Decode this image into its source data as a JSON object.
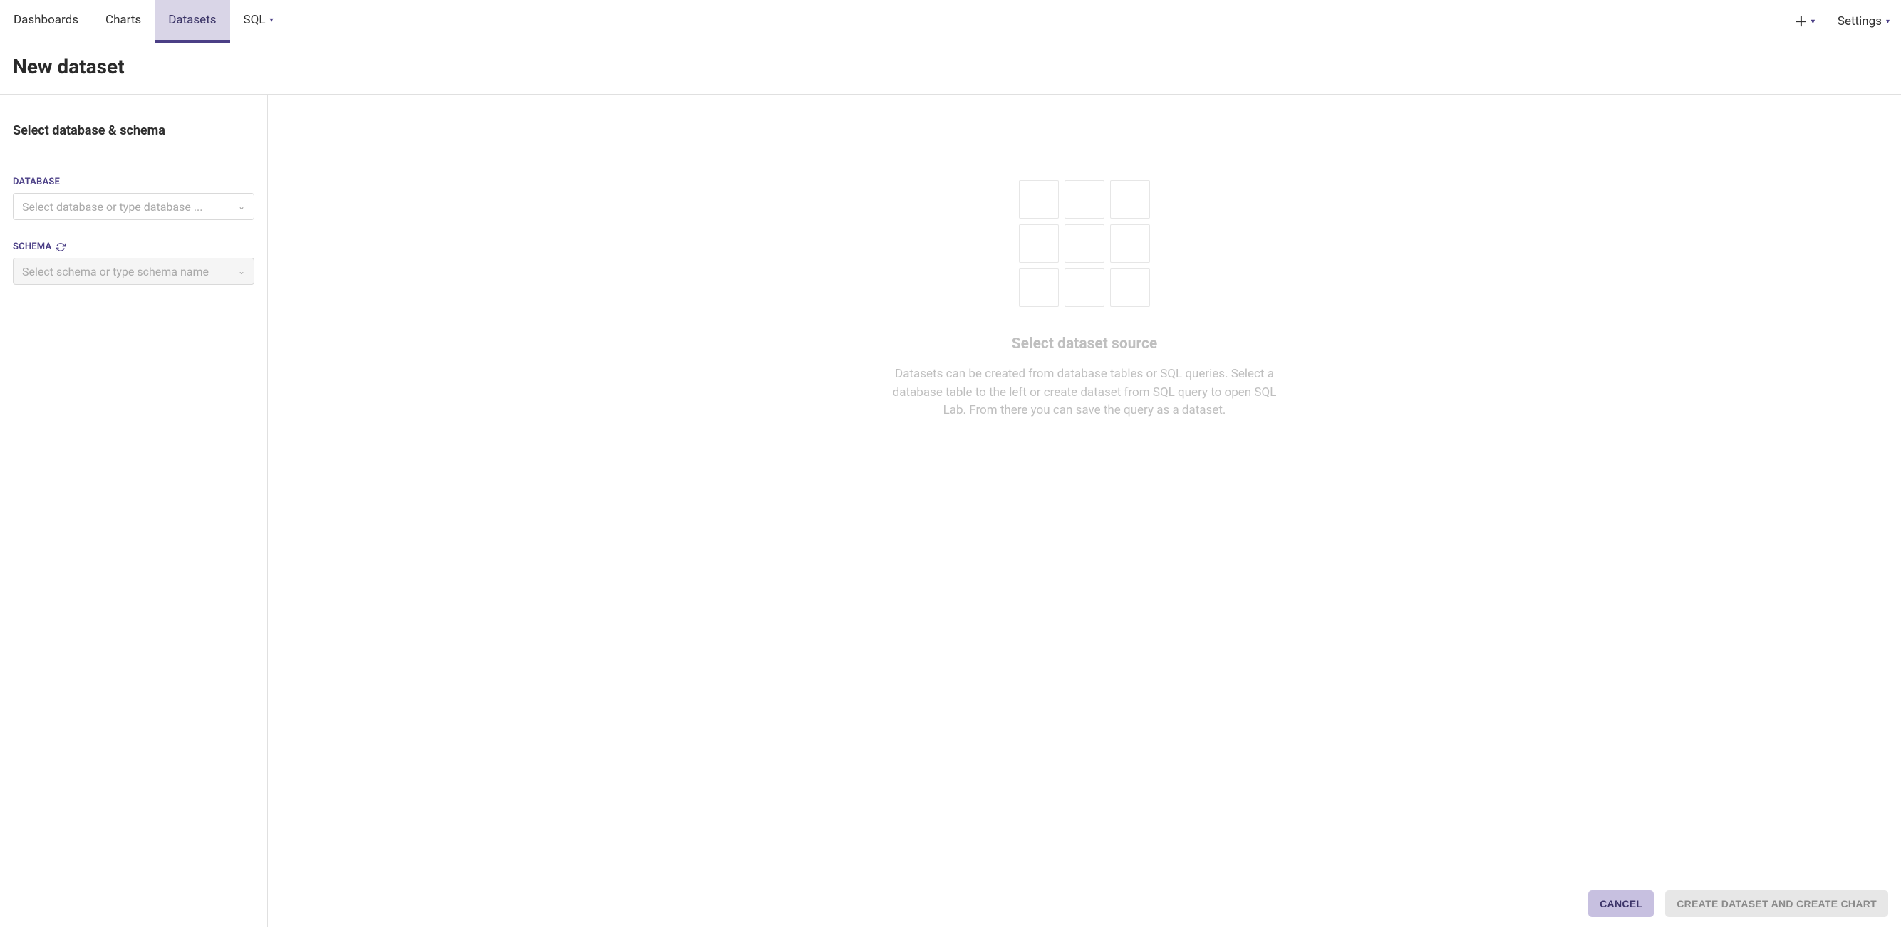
{
  "nav": {
    "items": [
      {
        "label": "Dashboards"
      },
      {
        "label": "Charts"
      },
      {
        "label": "Datasets"
      },
      {
        "label": "SQL"
      }
    ],
    "settings_label": "Settings"
  },
  "page": {
    "title": "New dataset"
  },
  "left": {
    "section_title": "Select database & schema",
    "database_label": "DATABASE",
    "database_placeholder": "Select database or type database ...",
    "schema_label": "SCHEMA",
    "schema_placeholder": "Select schema or type schema name"
  },
  "empty": {
    "title": "Select dataset source",
    "desc_pre": "Datasets can be created from database tables or SQL queries. Select a database table to the left or ",
    "link": "create dataset from SQL query",
    "desc_post": " to open SQL Lab. From there you can save the query as a dataset."
  },
  "footer": {
    "cancel": "CANCEL",
    "create": "CREATE DATASET AND CREATE CHART"
  }
}
